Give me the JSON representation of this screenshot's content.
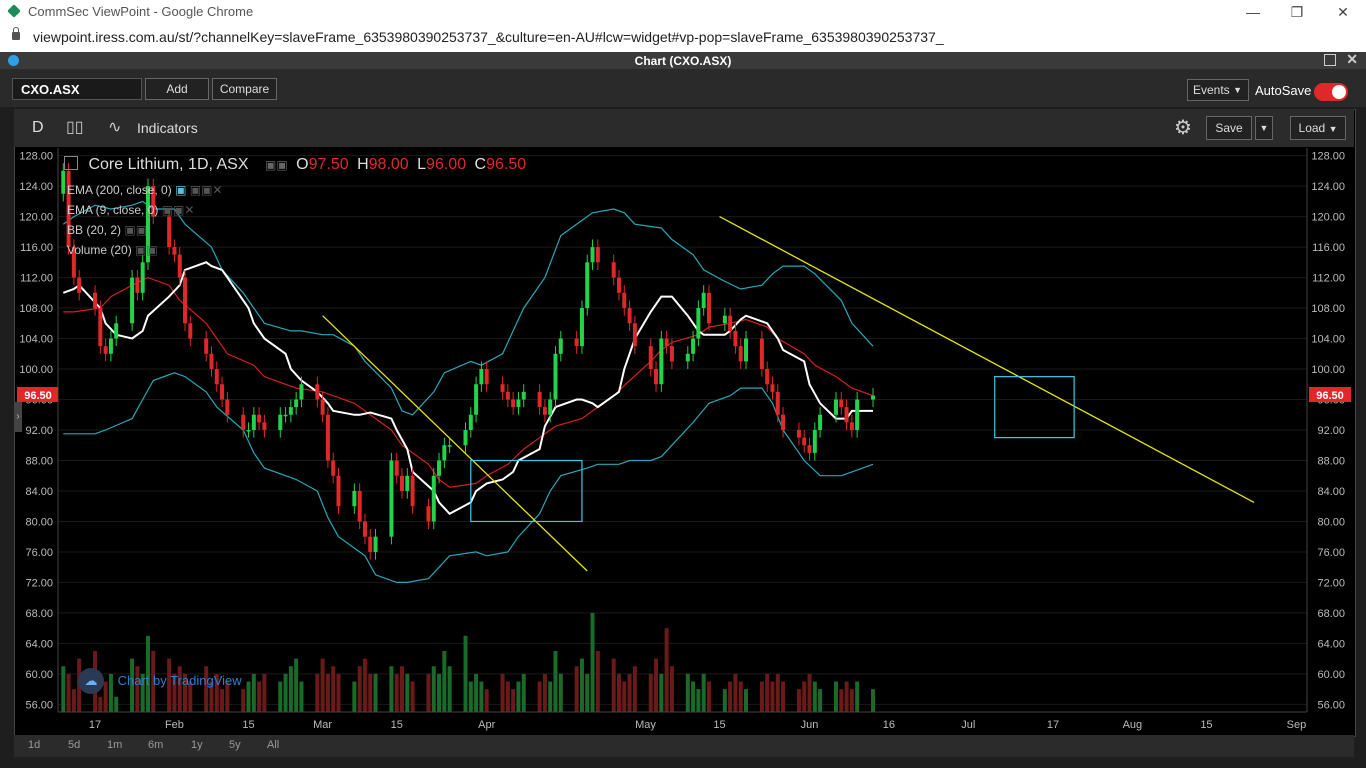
{
  "browser": {
    "window_title": "CommSec ViewPoint - Google Chrome",
    "url": "viewpoint.iress.com.au/st/?channelKey=slaveFrame_6353980390253737_&culture=en-AU#lcw=widget#vp-pop=slaveFrame_6353980390253737_"
  },
  "panel": {
    "title": "Chart (CXO.ASX)"
  },
  "toolbar": {
    "symbol": "CXO.ASX",
    "add_label": "Add",
    "compare_label": "Compare",
    "events_label": "Events",
    "autosave_label": "AutoSave"
  },
  "chart_toolbar": {
    "interval": "D",
    "indicators_label": "Indicators",
    "save_label": "Save",
    "load_label": "Load"
  },
  "legend": {
    "title": "Core Lithium, 1D, ASX",
    "o_label": "O",
    "o_value": "97.50",
    "h_label": "H",
    "h_value": "98.00",
    "l_label": "L",
    "l_value": "96.00",
    "c_label": "C",
    "c_value": "96.50",
    "studies": [
      "EMA (200, close, 0)",
      "EMA (9, close, 0)",
      "BB (20, 2)",
      "Volume (20)"
    ]
  },
  "watermark": "Chart by TradingView",
  "price_badge": "96.50",
  "ranges": [
    "1d",
    "5d",
    "1m",
    "6m",
    "1y",
    "5y",
    "All"
  ],
  "colors": {
    "up": "#22d44a",
    "down": "#e0282a",
    "ema9": "#ffffff",
    "ema_red": "#d62020",
    "bb": "#28a8b8",
    "trendline": "#e6e600",
    "box": "#3fc9e6",
    "vol_up": "#1a6b2a",
    "vol_down": "#6b1a1a"
  },
  "chart_data": {
    "type": "candlestick",
    "title": "Core Lithium, 1D, ASX",
    "ylim": [
      55,
      129
    ],
    "yticks": [
      128,
      124,
      120,
      116,
      112,
      108,
      104,
      100,
      96,
      92,
      88,
      84,
      80,
      76,
      72,
      68,
      64,
      60,
      56
    ],
    "xlim": [
      "2022-01-10",
      "2022-09-03"
    ],
    "xticks": [
      {
        "date": "2022-01-17",
        "label": "17"
      },
      {
        "date": "2022-02-01",
        "label": "Feb"
      },
      {
        "date": "2022-02-15",
        "label": "15"
      },
      {
        "date": "2022-03-01",
        "label": "Mar"
      },
      {
        "date": "2022-03-15",
        "label": "15"
      },
      {
        "date": "2022-04-01",
        "label": "Apr"
      },
      {
        "date": "2022-05-01",
        "label": "May"
      },
      {
        "date": "2022-05-15",
        "label": "15"
      },
      {
        "date": "2022-06-01",
        "label": "Jun"
      },
      {
        "date": "2022-06-16",
        "label": "16"
      },
      {
        "date": "2022-07-01",
        "label": "Jul"
      },
      {
        "date": "2022-07-17",
        "label": "17"
      },
      {
        "date": "2022-08-01",
        "label": "Aug"
      },
      {
        "date": "2022-08-15",
        "label": "15"
      },
      {
        "date": "2022-09-01",
        "label": "Sep"
      }
    ],
    "closes": [
      126,
      116,
      112,
      110,
      108,
      103,
      102,
      104,
      106,
      112,
      110,
      114,
      124,
      120,
      116,
      115,
      112,
      106,
      104,
      102,
      100,
      98,
      96,
      94,
      92,
      92,
      94,
      93,
      92,
      94,
      94,
      95,
      96,
      98,
      96,
      94,
      88,
      86,
      82,
      84,
      80,
      78,
      76,
      78,
      88,
      86,
      84,
      86,
      82,
      80,
      86,
      88,
      90,
      90,
      92,
      94,
      98,
      100,
      98,
      97,
      96,
      95,
      96,
      97,
      95,
      94,
      96,
      102,
      104,
      103,
      108,
      114,
      116,
      114,
      112,
      110,
      108,
      106,
      103,
      100,
      98,
      104,
      103,
      101,
      102,
      104,
      108,
      110,
      106,
      107,
      105,
      103,
      101,
      104,
      100,
      98,
      97,
      94,
      92,
      91,
      90,
      89,
      92,
      94,
      96,
      95,
      93,
      92,
      96,
      96.5
    ],
    "ema9": [
      110,
      110.5,
      111,
      108,
      106,
      104.5,
      104,
      105,
      107,
      109.5,
      111,
      113,
      114,
      113.5,
      113,
      112,
      108,
      106,
      104,
      102,
      100,
      98.5,
      97,
      95.5,
      94.5,
      94,
      94,
      94.3,
      93.5,
      92,
      89.5,
      86.5,
      84,
      82.5,
      81,
      82.5,
      84,
      85,
      85.5,
      86.5,
      88,
      89.5,
      92.5,
      95,
      96,
      96,
      95.5,
      95,
      97,
      100,
      104,
      107.5,
      109.5,
      109.5,
      107,
      105,
      104.5,
      104.5,
      105,
      106.5,
      107,
      106,
      104,
      102.5,
      101,
      98,
      95.5,
      93.5,
      93.5,
      94.5,
      94.5
    ],
    "ema_red_line": [
      107.5,
      107.5,
      108,
      109.5,
      111,
      112,
      111,
      109,
      106,
      104,
      102,
      100.5,
      99,
      98,
      97.5,
      97,
      96.5,
      95.5,
      94,
      92,
      90,
      87.5,
      85.5,
      84.5,
      85,
      86,
      87.5,
      89.5,
      91.5,
      92.5,
      93.5,
      94.5,
      96.5,
      98.5,
      101,
      102.5,
      103.5,
      104.5,
      105.5,
      106,
      106.5,
      105.5,
      104,
      102,
      100.5,
      99,
      97.5,
      96.5
    ],
    "bb_upper": [
      119,
      120,
      121.5,
      121,
      121.5,
      122,
      121,
      121,
      119,
      116,
      113,
      110,
      108,
      106,
      105,
      105,
      104.5,
      104.5,
      103,
      101,
      97.5,
      94.5,
      94,
      97,
      99.5,
      101,
      100.5,
      102,
      105,
      108,
      112,
      117.5,
      119.5,
      120.5,
      121,
      120.5,
      119,
      118.5,
      117,
      115,
      113,
      111.5,
      110.5,
      111,
      112.5,
      113.5,
      113.5,
      112.5,
      109,
      106,
      103
    ],
    "bb_lower": [
      91.5,
      91.5,
      91.5,
      92,
      93.5,
      96,
      98.5,
      99.5,
      99,
      97,
      95,
      92,
      89,
      87,
      86,
      85.5,
      84,
      80.5,
      78,
      75.5,
      73,
      72,
      72,
      72.5,
      74,
      75.5,
      76,
      75.5,
      76,
      78,
      81,
      84,
      86,
      87,
      87.5,
      87.5,
      88,
      88,
      88.5,
      90,
      93,
      95.5,
      96.5,
      97.5,
      97.5,
      95.5,
      92,
      88,
      86,
      86,
      86.5,
      87.5
    ],
    "volume": [
      61,
      60,
      58,
      62,
      63,
      57,
      59,
      60,
      57,
      62,
      61,
      60,
      65,
      63,
      62,
      60,
      61,
      60,
      59,
      61,
      59,
      60,
      58,
      59,
      58,
      59,
      60,
      59,
      60,
      59,
      60,
      61,
      62,
      59,
      60,
      62,
      60,
      61,
      60,
      59,
      61,
      62,
      60,
      60,
      61,
      60,
      61,
      60,
      59,
      60,
      61,
      60,
      63,
      61,
      65,
      59,
      60,
      59,
      58,
      60,
      59,
      58,
      59,
      60,
      59,
      60,
      59,
      63,
      60,
      61,
      62,
      60,
      68,
      63,
      62,
      60,
      59,
      60,
      61,
      60,
      62,
      60,
      66,
      61,
      60,
      59,
      58,
      60,
      59,
      58,
      59,
      60,
      59,
      58,
      59,
      60,
      59,
      60,
      59,
      58,
      59,
      60,
      59,
      58,
      59,
      58,
      59,
      58,
      59,
      58
    ],
    "trendlines": [
      {
        "from": [
          "2022-03-01",
          107
        ],
        "to": [
          "2022-04-20",
          73.5
        ]
      },
      {
        "from": [
          "2022-05-15",
          120
        ],
        "to": [
          "2022-08-24",
          82.5
        ]
      }
    ],
    "boxes": [
      {
        "from": [
          "2022-03-29",
          88
        ],
        "to": [
          "2022-04-19",
          80
        ]
      },
      {
        "from": [
          "2022-07-06",
          99
        ],
        "to": [
          "2022-07-21",
          91
        ]
      }
    ]
  }
}
